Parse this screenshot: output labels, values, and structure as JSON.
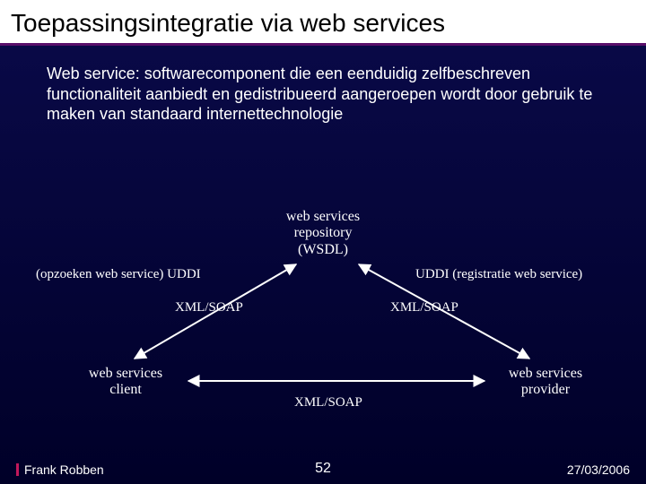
{
  "header": {
    "title": "Toepassingsintegratie via web services"
  },
  "intro": "Web service: softwarecomponent die een eenduidig zelfbeschreven functionaliteit aanbiedt en gedistribueerd aangeroepen wordt door gebruik te maken van standaard internettechnologie",
  "diagram": {
    "nodes": {
      "repo": "web services\nrepository\n(WSDL)",
      "client": "web services\nclient",
      "provider": "web services\nprovider"
    },
    "labels": {
      "uddi_left": "(opzoeken web service) UDDI",
      "uddi_right": "UDDI (registratie web service)",
      "xml_left": "XML/SOAP",
      "xml_right": "XML/SOAP",
      "xml_bottom": "XML/SOAP"
    }
  },
  "footer": {
    "author": "Frank Robben",
    "page": "52",
    "date": "27/03/2006"
  }
}
